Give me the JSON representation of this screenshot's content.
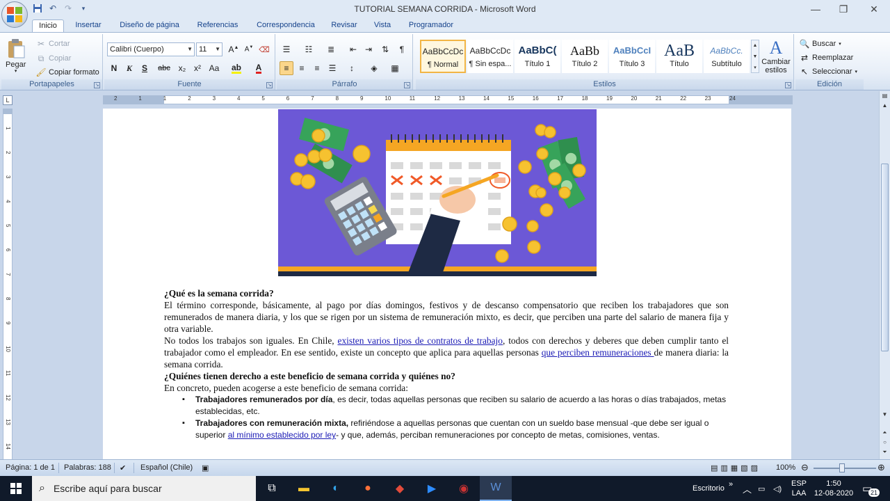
{
  "window": {
    "title": "TUTORIAL SEMANA CORRIDA - Microsoft Word",
    "minimize_icon": "minimize-icon",
    "maximize_icon": "restore-icon",
    "close_icon": "close-icon"
  },
  "tabs": [
    "Inicio",
    "Insertar",
    "Diseño de página",
    "Referencias",
    "Correspondencia",
    "Revisar",
    "Vista",
    "Programador"
  ],
  "ribbon": {
    "clipboard": {
      "paste": "Pegar",
      "cut": "Cortar",
      "copy": "Copiar",
      "format_painter": "Copiar formato",
      "label": "Portapapeles"
    },
    "font": {
      "name": "Calibri (Cuerpo)",
      "size": "11",
      "label": "Fuente",
      "bold": "N",
      "italic": "K",
      "underline": "S",
      "strike": "abc",
      "sub": "x₂",
      "sup": "x²",
      "case": "Aa"
    },
    "paragraph": {
      "label": "Párrafo"
    },
    "styles": {
      "label": "Estilos",
      "items": [
        {
          "sample": "AaBbCcDc",
          "name": "¶ Normal"
        },
        {
          "sample": "AaBbCcDc",
          "name": "¶ Sin espa..."
        },
        {
          "sample": "AaBbC(",
          "name": "Título 1"
        },
        {
          "sample": "AaBb",
          "name": "Título 2"
        },
        {
          "sample": "AaBbCcI",
          "name": "Título 3"
        },
        {
          "sample": "AaB",
          "name": "Título"
        },
        {
          "sample": "AaBbCc.",
          "name": "Subtítulo"
        }
      ],
      "change_styles": "Cambiar estilos"
    },
    "editing": {
      "find": "Buscar",
      "replace": "Reemplazar",
      "select": "Seleccionar",
      "label": "Edición"
    }
  },
  "document": {
    "heading1": "¿Qué es la semana corrida?",
    "para1": "El término corresponde, básicamente, al pago por días domingos, festivos y de descanso compensatorio que reciben los trabajadores que son remunerados de manera diaria, y los que se rigen por un sistema de remuneración mixto, es decir, que perciben una parte del salario de manera fija y otra variable.",
    "para2_a": "No todos los trabajos son iguales. En Chile, ",
    "para2_link1": "existen varios tipos de contratos de trabajo",
    "para2_b": ", todos con derechos y deberes que deben cumplir tanto el trabajador como el empleador. En ese sentido, existe un concepto que aplica para aquellas personas ",
    "para2_link2": "que perciben remuneraciones ",
    "para2_c": "de manera diaria: la semana corrida.",
    "heading2": "¿Quiénes tienen derecho a este beneficio de semana corrida y quiénes no?",
    "para3": "En concreto, pueden acogerse a este beneficio de semana corrida:",
    "bullet1_bold": "Trabajadores remunerados por día",
    "bullet1_text": ", es decir, todas aquellas personas que reciben su salario de acuerdo a las horas o días trabajados, metas establecidas, etc.",
    "bullet2_bold": "Trabajadores con remuneración mixta,",
    "bullet2_text_a": " refiriéndose a aquellas personas que cuentan con un sueldo base mensual -que debe ser igual o superior ",
    "bullet2_link": "al mínimo establecido por ley",
    "bullet2_text_b": "- y que, además, perciban remuneraciones por concepto de metas, comisiones, ventas."
  },
  "ruler": {
    "numbers": [
      "2",
      "1",
      "1",
      "2",
      "3",
      "4",
      "5",
      "6",
      "7",
      "8",
      "9",
      "10",
      "11",
      "12",
      "13",
      "14",
      "15",
      "16",
      "17",
      "18",
      "19",
      "20",
      "21",
      "22",
      "23",
      "24"
    ],
    "v_numbers": [
      "1",
      "2",
      "3",
      "4",
      "5",
      "6",
      "7",
      "8",
      "9",
      "10",
      "11",
      "12",
      "13",
      "14"
    ]
  },
  "status": {
    "page": "Página: 1 de 1",
    "words": "Palabras: 188",
    "language": "Español (Chile)",
    "zoom": "100%"
  },
  "taskbar": {
    "search_placeholder": "Escribe aquí para buscar",
    "desktop": "Escritorio",
    "lang": "ESP",
    "lang2": "LAA",
    "time": "1:50",
    "date": "12-08-2020",
    "notifications": "21"
  },
  "colors": {
    "hero_bg": "#6c58d6",
    "accent_orange": "#f5a623",
    "money_green": "#37a35a",
    "link_blue": "#1b1bb5"
  }
}
